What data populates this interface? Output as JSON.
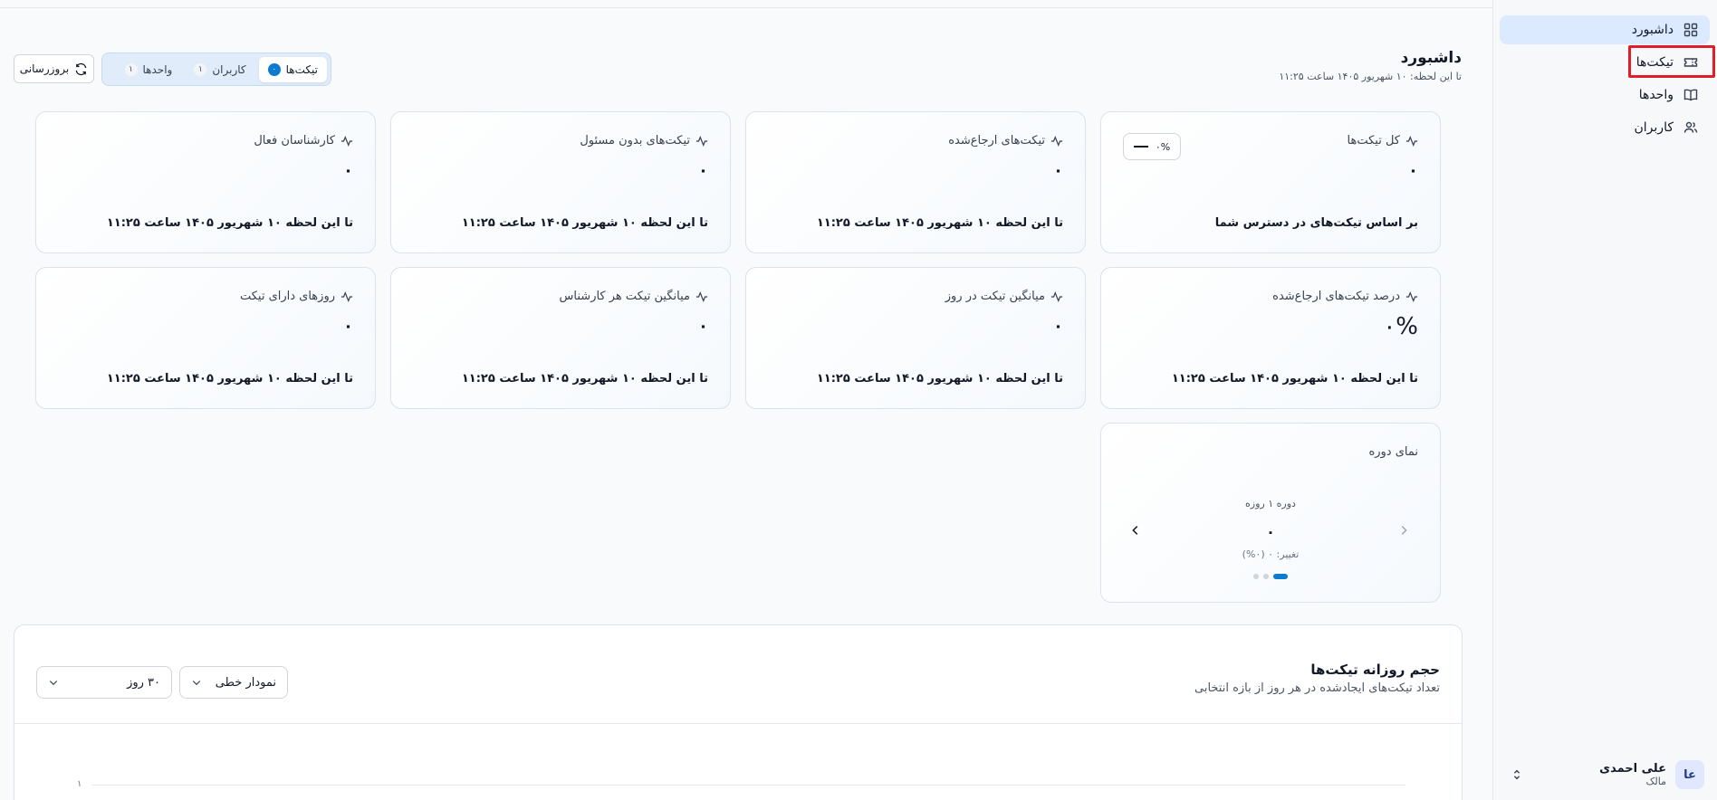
{
  "sidebar": {
    "items": [
      {
        "label": "داشبورد",
        "icon": "dashboard-grid-icon"
      },
      {
        "label": "تیکت‌ها",
        "icon": "ticket-icon"
      },
      {
        "label": "واحدها",
        "icon": "book-icon"
      },
      {
        "label": "کاربران",
        "icon": "users-icon"
      }
    ],
    "user": {
      "initials": "عا",
      "name": "علی احمدی",
      "role": "مالک"
    }
  },
  "header": {
    "title": "داشبورد",
    "subtitle": "تا این لحظه: ۱۰ شهریور ۱۴۰۵ ساعت ۱۱:۲۵"
  },
  "toolbar": {
    "refresh_label": "بروزرسانی"
  },
  "tabs": [
    {
      "label": "تیکت‌ها",
      "badge": "۰",
      "active": true
    },
    {
      "label": "کاربران",
      "badge": "۱",
      "active": false
    },
    {
      "label": "واحدها",
      "badge": "۱",
      "active": false
    }
  ],
  "stats": {
    "total": {
      "title": "کل تیکت‌ها",
      "value": "۰",
      "footer": "بر اساس تیکت‌های در دسترس شما",
      "trend": "۰%"
    },
    "referred": {
      "title": "تیکت‌های ارجاع‌شده",
      "value": "۰",
      "footer": "تا این لحظه ۱۰ شهریور ۱۴۰۵ ساعت ۱۱:۲۵"
    },
    "unassigned": {
      "title": "تیکت‌های بدون مسئول",
      "value": "۰",
      "footer": "تا این لحظه ۱۰ شهریور ۱۴۰۵ ساعت ۱۱:۲۵"
    },
    "active_agents": {
      "title": "کارشناسان فعال",
      "value": "۰",
      "footer": "تا این لحظه ۱۰ شهریور ۱۴۰۵ ساعت ۱۱:۲۵"
    },
    "referred_pct": {
      "title": "درصد تیکت‌های ارجاع‌شده",
      "value": "۰%",
      "footer": "تا این لحظه ۱۰ شهریور ۱۴۰۵ ساعت ۱۱:۲۵"
    },
    "avg_per_day": {
      "title": "میانگین تیکت در روز",
      "value": "۰",
      "footer": "تا این لحظه ۱۰ شهریور ۱۴۰۵ ساعت ۱۱:۲۵"
    },
    "avg_per_agent": {
      "title": "میانگین تیکت هر کارشناس",
      "value": "۰",
      "footer": "تا این لحظه ۱۰ شهریور ۱۴۰۵ ساعت ۱۱:۲۵"
    },
    "days_with_tickets": {
      "title": "روزهای دارای تیکت",
      "value": "۰",
      "footer": "تا این لحظه ۱۰ شهریور ۱۴۰۵ ساعت ۱۱:۲۵"
    }
  },
  "period": {
    "title": "نمای دوره",
    "label": "دوره ۱ روزه",
    "value": "۰",
    "change": "تغییر: ۰ (۰%)"
  },
  "chart": {
    "title": "حجم روزانه تیکت‌ها",
    "subtitle": "تعداد تیکت‌های ایجادشده در هر روز از بازه انتخابی",
    "chart_type_select": "نمودار خطی",
    "range_select": "۳۰ روز",
    "y_tick": "۱"
  },
  "colors": {
    "accent": "#0b7ad1",
    "active_nav": "#dbeafe",
    "highlight": "#e11d2a"
  }
}
